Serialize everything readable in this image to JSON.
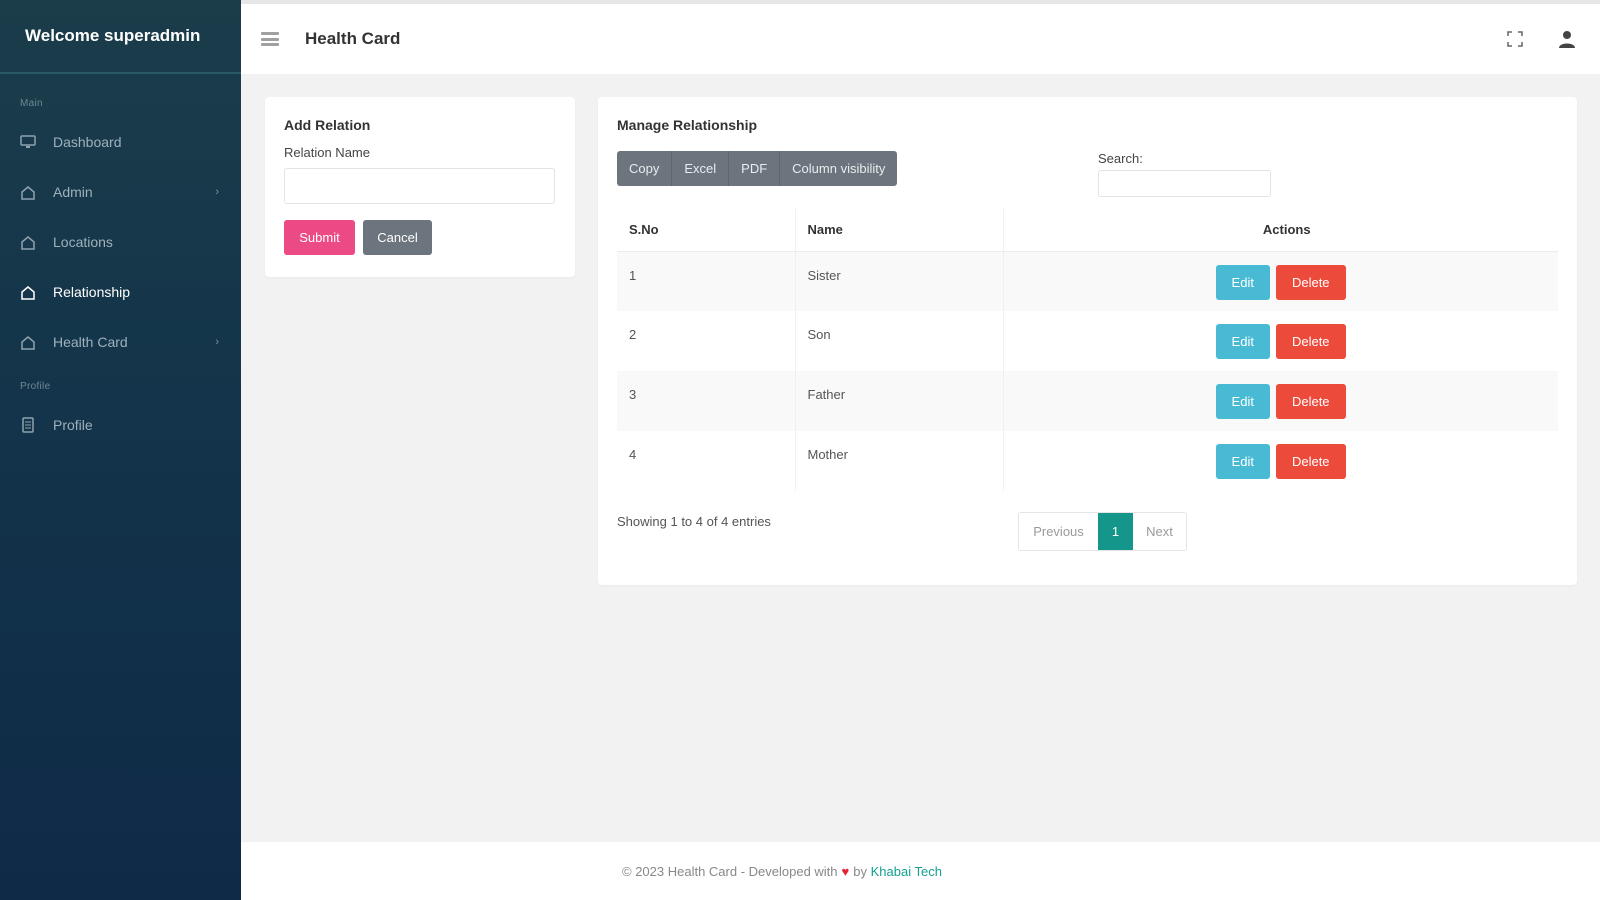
{
  "sidebar": {
    "brand": "Welcome superadmin",
    "section_main": "Main",
    "section_profile": "Profile",
    "items": [
      {
        "label": "Dashboard",
        "icon": "monitor-icon",
        "has_submenu": false
      },
      {
        "label": "Admin",
        "icon": "home-icon",
        "has_submenu": true
      },
      {
        "label": "Locations",
        "icon": "home-icon",
        "has_submenu": false
      },
      {
        "label": "Relationship",
        "icon": "home-icon",
        "has_submenu": false,
        "active": true
      },
      {
        "label": "Health Card",
        "icon": "home-icon",
        "has_submenu": true
      },
      {
        "label": "Profile",
        "icon": "document-icon",
        "has_submenu": false
      }
    ]
  },
  "header": {
    "title": "Health Card",
    "icons": [
      "menu-icon",
      "fullscreen-icon",
      "user-icon"
    ]
  },
  "add_relation": {
    "title": "Add Relation",
    "field_label": "Relation Name",
    "field_value": "",
    "submit_label": "Submit",
    "cancel_label": "Cancel"
  },
  "manage": {
    "title": "Manage Relationship",
    "toolbar": [
      "Copy",
      "Excel",
      "PDF",
      "Column visibility"
    ],
    "search_label": "Search:",
    "search_value": "",
    "columns": [
      "S.No",
      "Name",
      "Actions"
    ],
    "rows": [
      {
        "sno": "1",
        "name": "Sister"
      },
      {
        "sno": "2",
        "name": "Son"
      },
      {
        "sno": "3",
        "name": "Father"
      },
      {
        "sno": "4",
        "name": "Mother"
      }
    ],
    "edit_label": "Edit",
    "delete_label": "Delete",
    "info": "Showing 1 to 4 of 4 entries",
    "pagination": {
      "prev": "Previous",
      "current": "1",
      "next": "Next"
    }
  },
  "footer": {
    "text": "© 2023 Health Card - Developed with",
    "by": "by",
    "link": "Khabai Tech"
  },
  "colors": {
    "sidebar_top": "#1b3d4a",
    "sidebar_bottom": "#0f2a47",
    "submit": "#ec4a84",
    "cancel": "#6c757d",
    "edit": "#49bad3",
    "delete": "#ec4a3b",
    "page_active": "#14968a",
    "link": "#15a08f"
  }
}
